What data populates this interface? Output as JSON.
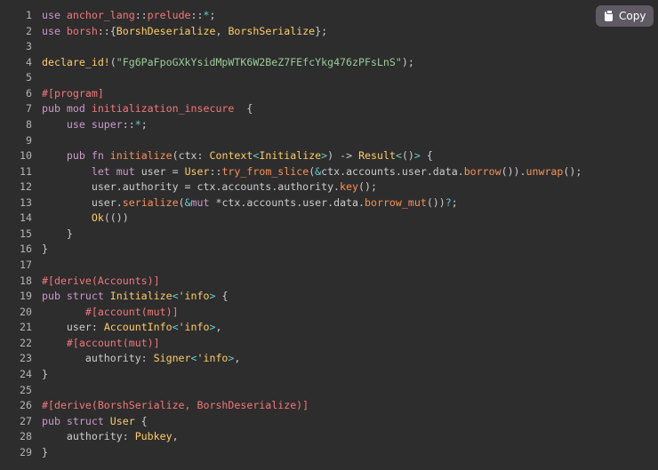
{
  "copy_button": {
    "label": "Copy",
    "icon": "clipboard-icon"
  },
  "colors": {
    "background": "#2d2d2d",
    "keyword": "#cc99cc",
    "identifier": "#f2777a",
    "function": "#f99157",
    "type": "#ffcc66",
    "string": "#99cc99",
    "punctuation": "#66cccc",
    "text": "#cccccc"
  },
  "lines": [
    [
      [
        "use ",
        "kw"
      ],
      [
        "anchor_lang",
        "id"
      ],
      [
        "::",
        "tx"
      ],
      [
        "prelude",
        "id"
      ],
      [
        "::",
        "tx"
      ],
      [
        "*",
        "pu"
      ],
      [
        ";",
        "tx"
      ]
    ],
    [
      [
        "use ",
        "kw"
      ],
      [
        "borsh",
        "id"
      ],
      [
        "::{",
        "tx"
      ],
      [
        "BorshDeserialize",
        "ty"
      ],
      [
        ", ",
        "tx"
      ],
      [
        "BorshSerialize",
        "ty"
      ],
      [
        "};",
        "tx"
      ]
    ],
    [],
    [
      [
        "declare_id!",
        "ty"
      ],
      [
        "(",
        "tx"
      ],
      [
        "\"Fg6PaFpoGXkYsidMpWTK6W2BeZ7FEfcYkg476zPFsLnS\"",
        "st"
      ],
      [
        ");",
        "tx"
      ]
    ],
    [],
    [
      [
        "#[program]",
        "id"
      ]
    ],
    [
      [
        "pub mod ",
        "kw"
      ],
      [
        "initialization_insecure",
        "id"
      ],
      [
        "  {",
        "tx"
      ]
    ],
    [
      [
        "    ",
        "tx"
      ],
      [
        "use super",
        "kw"
      ],
      [
        "::",
        "tx"
      ],
      [
        "*",
        "pu"
      ],
      [
        ";",
        "tx"
      ]
    ],
    [],
    [
      [
        "    ",
        "tx"
      ],
      [
        "pub fn ",
        "kw"
      ],
      [
        "initialize",
        "fn"
      ],
      [
        "(ctx: ",
        "tx"
      ],
      [
        "Context",
        "ty"
      ],
      [
        "<",
        "pu"
      ],
      [
        "Initialize",
        "ty"
      ],
      [
        ">",
        "pu"
      ],
      [
        ") -> ",
        "tx"
      ],
      [
        "Result",
        "ty"
      ],
      [
        "<",
        "pu"
      ],
      [
        "()",
        "tx"
      ],
      [
        ">",
        "pu"
      ],
      [
        " {",
        "tx"
      ]
    ],
    [
      [
        "        ",
        "tx"
      ],
      [
        "let mut ",
        "kw"
      ],
      [
        "user = ",
        "tx"
      ],
      [
        "User",
        "ty"
      ],
      [
        "::",
        "tx"
      ],
      [
        "try_from_slice",
        "fn"
      ],
      [
        "(",
        "tx"
      ],
      [
        "&",
        "pu"
      ],
      [
        "ctx.accounts.user.data.",
        "tx"
      ],
      [
        "borrow",
        "fn"
      ],
      [
        "()).",
        "tx"
      ],
      [
        "unwrap",
        "fn"
      ],
      [
        "();",
        "tx"
      ]
    ],
    [
      [
        "        user.authority = ctx.accounts.authority.",
        "tx"
      ],
      [
        "key",
        "fn"
      ],
      [
        "();",
        "tx"
      ]
    ],
    [
      [
        "        user.",
        "tx"
      ],
      [
        "serialize",
        "fn"
      ],
      [
        "(",
        "tx"
      ],
      [
        "&",
        "pu"
      ],
      [
        "mut ",
        "kw"
      ],
      [
        "*ctx.accounts.user.data.",
        "tx"
      ],
      [
        "borrow_mut",
        "fn"
      ],
      [
        "())",
        "tx"
      ],
      [
        "?",
        "pu"
      ],
      [
        ";",
        "tx"
      ]
    ],
    [
      [
        "        ",
        "tx"
      ],
      [
        "Ok",
        "ty"
      ],
      [
        "(())",
        "tx"
      ]
    ],
    [
      [
        "    }",
        "tx"
      ]
    ],
    [
      [
        "}",
        "tx"
      ]
    ],
    [],
    [
      [
        "#[derive(Accounts)]",
        "id"
      ]
    ],
    [
      [
        "pub struct ",
        "kw"
      ],
      [
        "Initialize",
        "ty"
      ],
      [
        "<",
        "pu"
      ],
      [
        "'info",
        "ty"
      ],
      [
        ">",
        "pu"
      ],
      [
        " {",
        "tx"
      ]
    ],
    [
      [
        "       ",
        "tx"
      ],
      [
        "#[account(mut)]",
        "id"
      ]
    ],
    [
      [
        "    user: ",
        "tx"
      ],
      [
        "AccountInfo",
        "ty"
      ],
      [
        "<",
        "pu"
      ],
      [
        "'info",
        "ty"
      ],
      [
        ">",
        "pu"
      ],
      [
        ",",
        "tx"
      ]
    ],
    [
      [
        "    ",
        "tx"
      ],
      [
        "#[account(mut)]",
        "id"
      ]
    ],
    [
      [
        "       authority: ",
        "tx"
      ],
      [
        "Signer",
        "ty"
      ],
      [
        "<",
        "pu"
      ],
      [
        "'info",
        "ty"
      ],
      [
        ">",
        "pu"
      ],
      [
        ",",
        "tx"
      ]
    ],
    [
      [
        "}",
        "tx"
      ]
    ],
    [],
    [
      [
        "#[derive(BorshSerialize, BorshDeserialize)]",
        "id"
      ]
    ],
    [
      [
        "pub struct ",
        "kw"
      ],
      [
        "User",
        "ty"
      ],
      [
        " {",
        "tx"
      ]
    ],
    [
      [
        "    authority: ",
        "tx"
      ],
      [
        "Pubkey",
        "ty"
      ],
      [
        ",",
        "tx"
      ]
    ],
    [
      [
        "}",
        "tx"
      ]
    ]
  ]
}
